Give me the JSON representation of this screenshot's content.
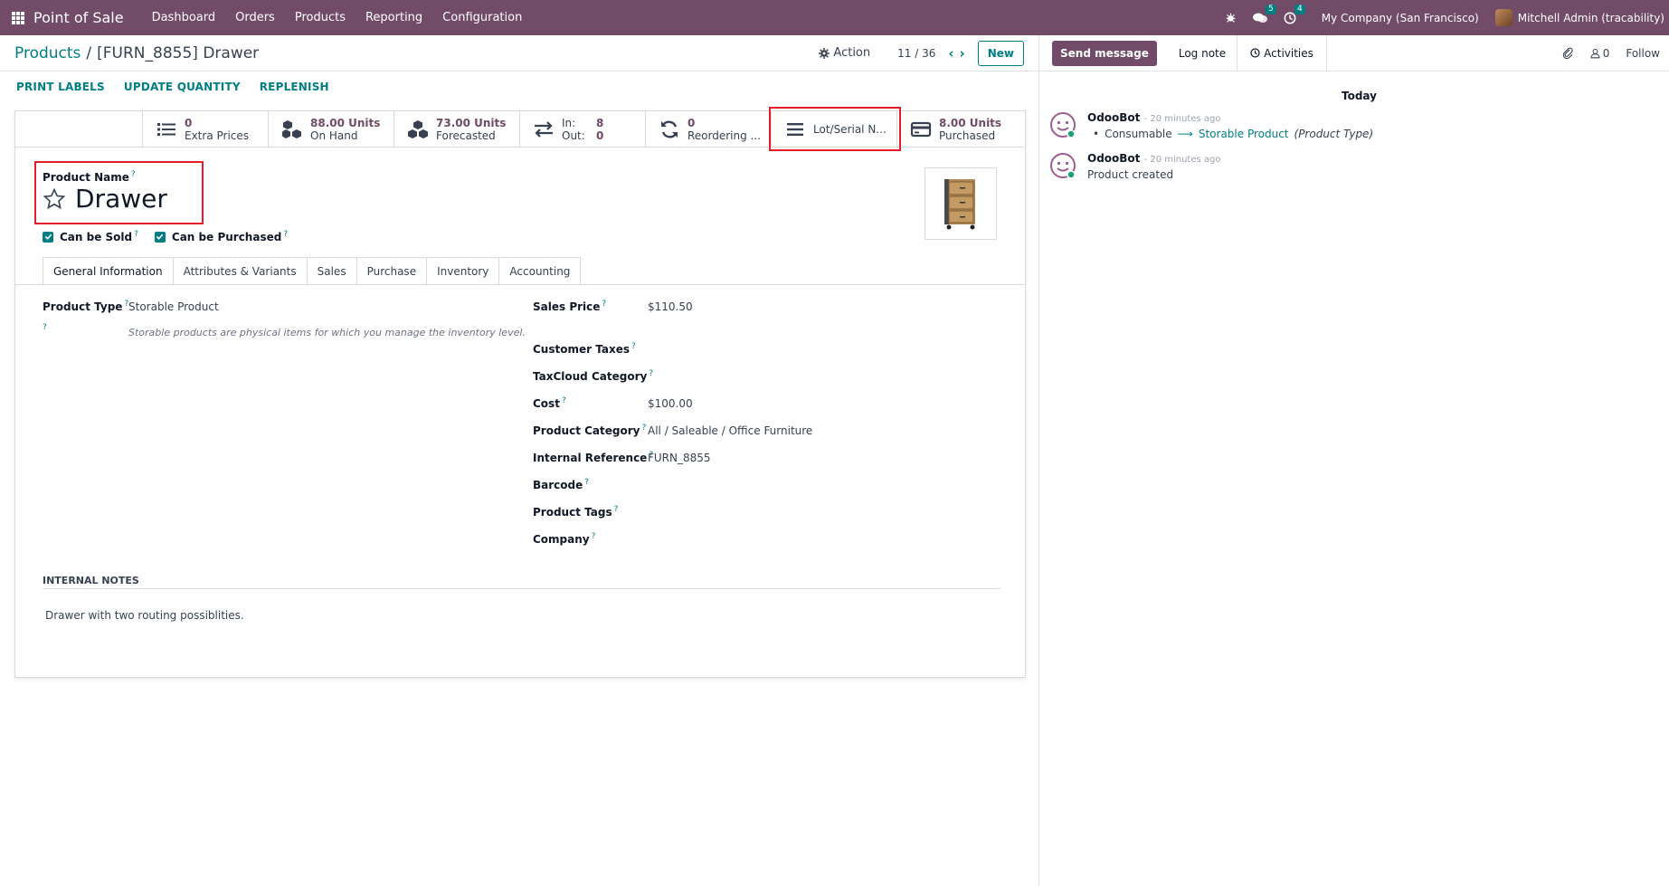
{
  "app": {
    "brand": "Point of Sale",
    "menu": [
      "Dashboard",
      "Orders",
      "Products",
      "Reporting",
      "Configuration"
    ],
    "messages_badge": "5",
    "activities_badge": "4",
    "company": "My Company (San Francisco)",
    "user": "Mitchell Admin (tracability)"
  },
  "control_panel": {
    "breadcrumb_root": "Products",
    "breadcrumb_sep": "/",
    "breadcrumb_current": "[FURN_8855] Drawer",
    "action_label": "Action",
    "pager": "11 / 36",
    "new_label": "New"
  },
  "statusbar": {
    "print_labels": "PRINT LABELS",
    "update_quantity": "UPDATE QUANTITY",
    "replenish": "REPLENISH"
  },
  "smart_buttons": {
    "extra_prices_value": "0",
    "extra_prices_label": "Extra Prices",
    "on_hand_value": "88.00 Units",
    "on_hand_label": "On Hand",
    "forecasted_value": "73.00 Units",
    "forecasted_label": "Forecasted",
    "in_label": "In:",
    "in_value": "8",
    "out_label": "Out:",
    "out_value": "0",
    "reordering_value": "0",
    "reordering_label": "Reordering ...",
    "lots_label": "Lot/Serial N...",
    "purchased_value": "8.00 Units",
    "purchased_label": "Purchased"
  },
  "product": {
    "name_label": "Product Name",
    "name": "Drawer",
    "can_be_sold": "Can be Sold",
    "can_be_purchased": "Can be Purchased"
  },
  "tabs": [
    "General Information",
    "Attributes & Variants",
    "Sales",
    "Purchase",
    "Inventory",
    "Accounting"
  ],
  "general": {
    "product_type_label": "Product Type",
    "product_type": "Storable Product",
    "product_type_help": "Storable products are physical items for which you manage the inventory level.",
    "sales_price_label": "Sales Price",
    "sales_price": "$110.50",
    "customer_taxes_label": "Customer Taxes",
    "taxcloud_label": "TaxCloud Category",
    "cost_label": "Cost",
    "cost": "$100.00",
    "category_label": "Product Category",
    "category": "All / Saleable / Office Furniture",
    "internal_ref_label": "Internal Reference",
    "internal_ref": "FURN_8855",
    "barcode_label": "Barcode",
    "tags_label": "Product Tags",
    "company_label": "Company",
    "help_mark": "?"
  },
  "notes": {
    "title": "INTERNAL NOTES",
    "body": "Drawer with two routing possiblities."
  },
  "chatter": {
    "send_message": "Send message",
    "log_note": "Log note",
    "activities": "Activities",
    "followers_count": "0",
    "follow": "Follow",
    "date_sep": "Today",
    "messages": [
      {
        "author": "OdooBot",
        "time": "- 20 minutes ago",
        "old_value": "Consumable",
        "new_value": "Storable Product",
        "field": "(Product Type)"
      },
      {
        "author": "OdooBot",
        "time": "- 20 minutes ago",
        "body": "Product created"
      }
    ]
  },
  "colors": {
    "brand": "#714b67",
    "accent": "#017e84",
    "highlight": "#e21c28"
  }
}
